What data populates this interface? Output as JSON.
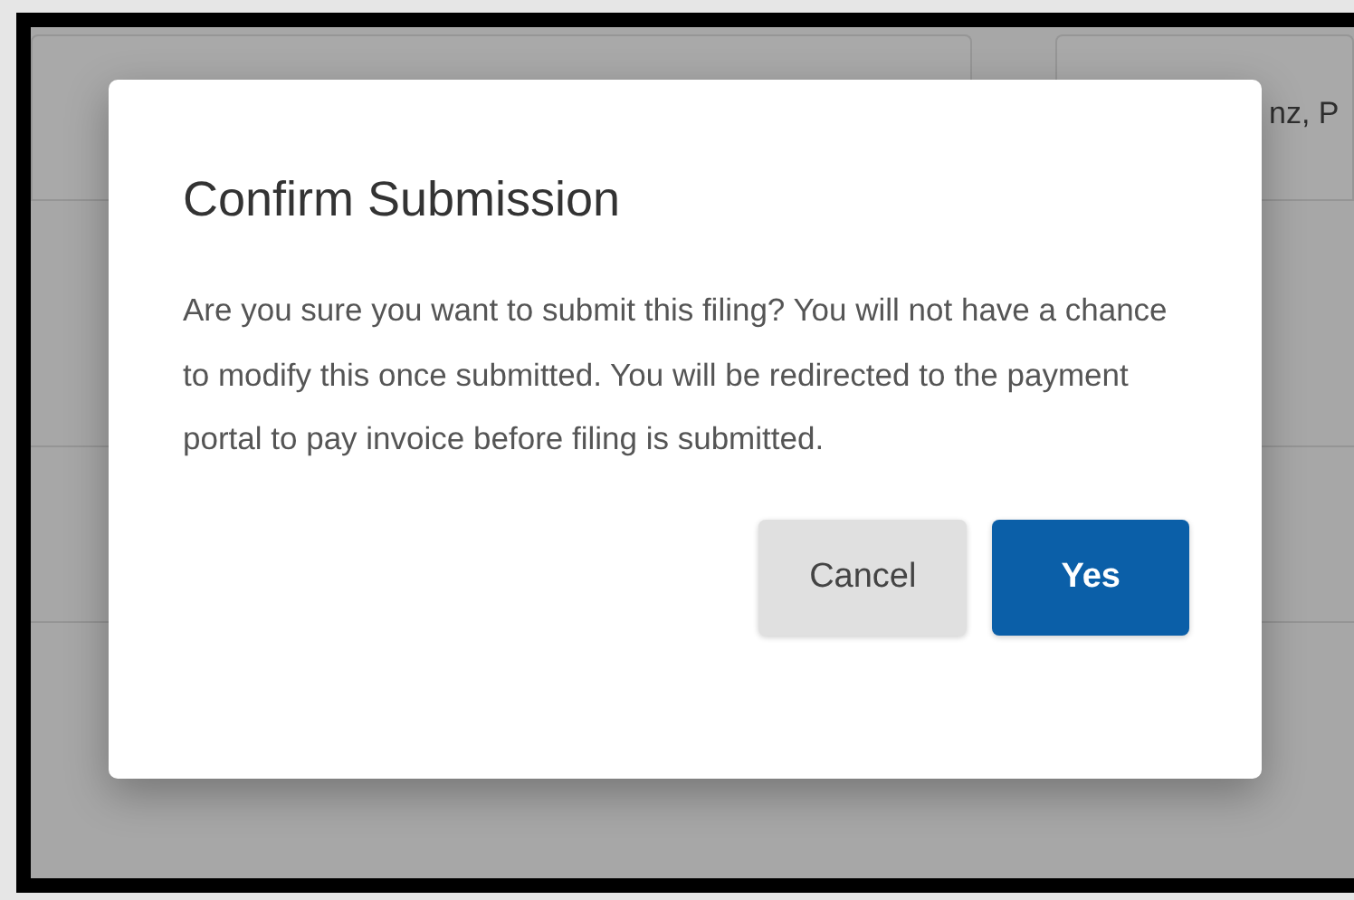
{
  "background": {
    "card_text": "nz, P"
  },
  "dialog": {
    "title": "Confirm Submission",
    "message": "Are you sure you want to submit this filing? You will not have a chance to modify this once submitted. You will be redirected to the payment portal to pay invoice before filing is submitted.",
    "buttons": [
      {
        "label": "Cancel",
        "kind": "secondary"
      },
      {
        "label": "Yes",
        "kind": "primary"
      }
    ]
  }
}
